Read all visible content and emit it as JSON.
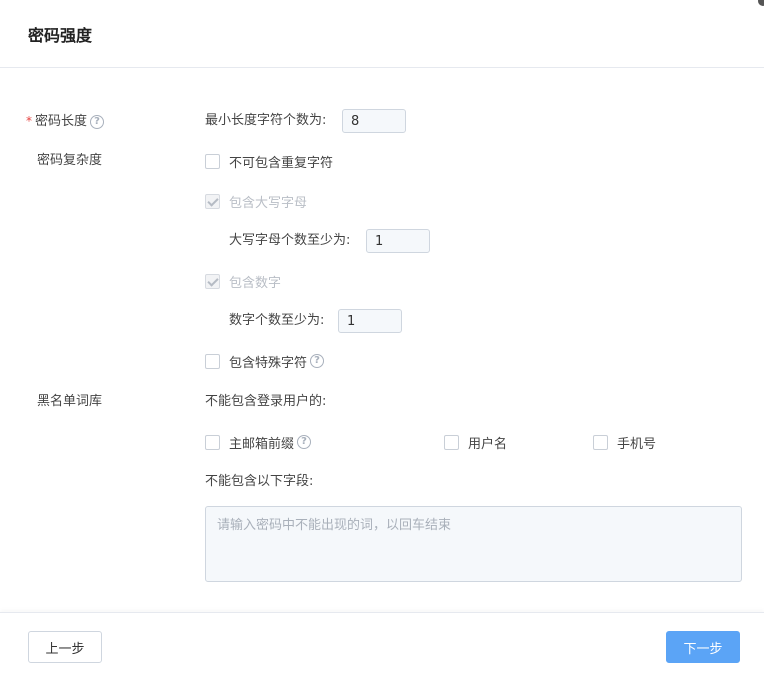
{
  "dialog": {
    "title": "密码强度"
  },
  "length": {
    "required_mark": "*",
    "label": "密码长度",
    "min_label": "最小长度字符个数为:",
    "min_value": "8"
  },
  "complexity": {
    "label": "密码复杂度",
    "no_repeat": {
      "label": "不可包含重复字符",
      "checked": false
    },
    "uppercase": {
      "label": "包含大写字母",
      "checked": true,
      "disabled": true
    },
    "uppercase_min_label": "大写字母个数至少为:",
    "uppercase_min_value": "1",
    "digits": {
      "label": "包含数字",
      "checked": true,
      "disabled": true
    },
    "digits_min_label": "数字个数至少为:",
    "digits_min_value": "1",
    "special": {
      "label": "包含特殊字符",
      "checked": false
    }
  },
  "blacklist": {
    "label": "黑名单词库",
    "user_fields_label": "不能包含登录用户的:",
    "email_prefix": "主邮箱前缀",
    "username": "用户名",
    "phone": "手机号",
    "fields_label": "不能包含以下字段:",
    "placeholder": "请输入密码中不能出现的词，以回车结束"
  },
  "footer": {
    "prev_label": "上一步",
    "next_label": "下一步"
  },
  "colors": {
    "primary": "#5ba4f6",
    "required": "#e64340"
  },
  "icons": {
    "help": "question-circle-icon",
    "check": "check-icon"
  },
  "help_glyph": "?"
}
